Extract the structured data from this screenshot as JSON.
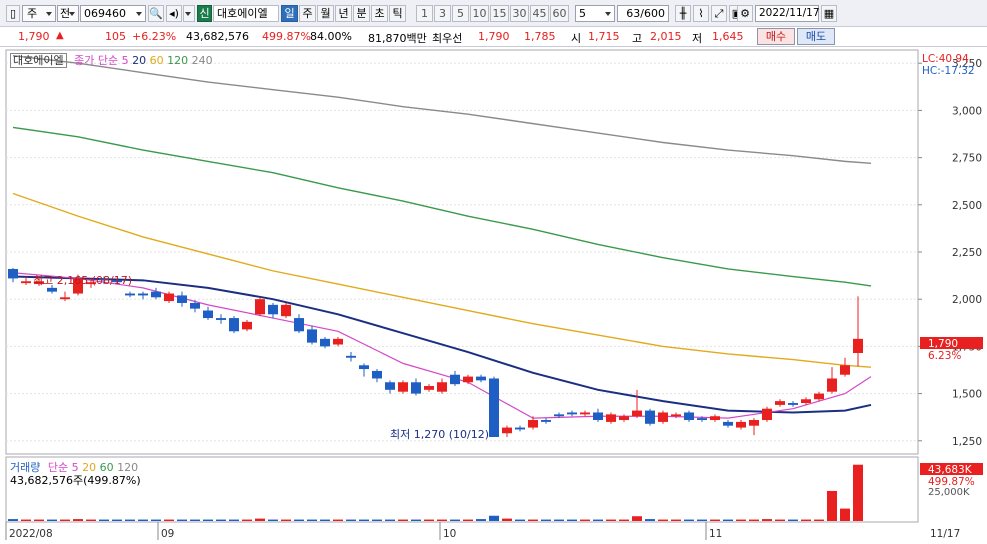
{
  "toolbar": {
    "mode1": "주",
    "mode2": "전",
    "code": "069460",
    "new_badge": "신",
    "name": "대호에이엘",
    "periods": [
      "일",
      "주",
      "월",
      "년",
      "분",
      "초",
      "틱"
    ],
    "selected_period": "일",
    "minutes": [
      "1",
      "3",
      "5",
      "10",
      "15",
      "30",
      "45",
      "60"
    ],
    "interval": "5",
    "count": "63/600",
    "date": "2022/11/17"
  },
  "quote": {
    "price": "1,790",
    "arrow": "▲",
    "change": "105",
    "change_pct": "+6.23%",
    "volume": "43,682,576",
    "volume_ratio": "499.87%",
    "strength": "84.00%",
    "amount": "81,870백만",
    "best_label": "최우선",
    "best_ask": "1,790",
    "best_bid": "1,785",
    "open_label": "시",
    "open": "1,715",
    "high_label": "고",
    "high": "2,015",
    "low_label": "저",
    "low": "1,645",
    "buy": "매수",
    "sell": "매도"
  },
  "price_panel": {
    "name_tag": "대호에이엘",
    "ma_label": "종가 단순",
    "ma_periods": [
      "5",
      "20",
      "60",
      "120",
      "240"
    ],
    "lc": "LC:40.94",
    "hc": "HC:-17.32",
    "last_price": "1,790",
    "last_pct": "6.23%",
    "max_annotation": "최고 2,165 (08/17)",
    "min_annotation": "최저 1,270 (10/12)"
  },
  "volume_panel": {
    "label": "거래량",
    "ma_label": "단순",
    "ma_periods": [
      "5",
      "20",
      "60",
      "120"
    ],
    "value_line": "43,682,576주(499.87%)",
    "last_volume": "43,683K",
    "last_pct": "499.87%",
    "axis_tick": "25,000K"
  },
  "x_axis": {
    "labels": [
      "2022/08",
      "09",
      "10",
      "11"
    ],
    "right_label": "11/17"
  },
  "colors": {
    "up": "#e8201f",
    "down": "#1f5fc4",
    "ma5": "#d448c8",
    "ma20": "#1b2f82",
    "ma60": "#e2aa1a",
    "ma120": "#3a9a4a",
    "ma240": "#8a8a8a"
  },
  "chart_data": {
    "type": "candlestick",
    "y_ticks": [
      1250,
      1500,
      1750,
      2000,
      2250,
      2500,
      2750,
      3000,
      3250
    ],
    "ylim": [
      1180,
      3320
    ],
    "candles": [
      [
        2160,
        2110,
        2165,
        2090
      ],
      [
        2085,
        2095,
        2120,
        2075
      ],
      [
        2080,
        2095,
        2120,
        2070
      ],
      [
        2060,
        2040,
        2075,
        2030
      ],
      [
        2000,
        2010,
        2040,
        1990
      ],
      [
        2030,
        2110,
        2130,
        2020
      ],
      [
        2080,
        2090,
        2110,
        2060
      ],
      [
        2110,
        2100,
        2120,
        2080
      ],
      [
        2100,
        2090,
        2110,
        2080
      ],
      [
        2030,
        2020,
        2040,
        2010
      ],
      [
        2030,
        2020,
        2040,
        2000
      ],
      [
        2040,
        2010,
        2060,
        2000
      ],
      [
        1990,
        2030,
        2040,
        1980
      ],
      [
        2020,
        1980,
        2040,
        1960
      ],
      [
        1980,
        1950,
        1995,
        1930
      ],
      [
        1940,
        1900,
        1960,
        1890
      ],
      [
        1900,
        1890,
        1920,
        1870
      ],
      [
        1900,
        1830,
        1910,
        1820
      ],
      [
        1840,
        1880,
        1890,
        1830
      ],
      [
        1920,
        2000,
        2010,
        1910
      ],
      [
        1970,
        1920,
        1980,
        1900
      ],
      [
        1910,
        1970,
        1980,
        1900
      ],
      [
        1900,
        1830,
        1920,
        1820
      ],
      [
        1840,
        1770,
        1860,
        1760
      ],
      [
        1790,
        1750,
        1800,
        1740
      ],
      [
        1760,
        1790,
        1800,
        1750
      ],
      [
        1700,
        1690,
        1720,
        1670
      ],
      [
        1650,
        1630,
        1660,
        1590
      ],
      [
        1620,
        1580,
        1630,
        1560
      ],
      [
        1560,
        1520,
        1570,
        1500
      ],
      [
        1510,
        1560,
        1570,
        1500
      ],
      [
        1560,
        1500,
        1580,
        1490
      ],
      [
        1520,
        1540,
        1550,
        1510
      ],
      [
        1510,
        1560,
        1580,
        1500
      ],
      [
        1600,
        1550,
        1620,
        1540
      ],
      [
        1560,
        1590,
        1600,
        1550
      ],
      [
        1590,
        1570,
        1600,
        1560
      ],
      [
        1580,
        1270,
        1590,
        1270
      ],
      [
        1290,
        1320,
        1330,
        1270
      ],
      [
        1320,
        1310,
        1330,
        1300
      ],
      [
        1320,
        1360,
        1380,
        1310
      ],
      [
        1360,
        1350,
        1370,
        1340
      ],
      [
        1390,
        1380,
        1400,
        1370
      ],
      [
        1400,
        1390,
        1410,
        1380
      ],
      [
        1390,
        1400,
        1410,
        1380
      ],
      [
        1400,
        1360,
        1420,
        1350
      ],
      [
        1350,
        1390,
        1400,
        1340
      ],
      [
        1360,
        1380,
        1390,
        1350
      ],
      [
        1380,
        1410,
        1520,
        1370
      ],
      [
        1410,
        1340,
        1420,
        1330
      ],
      [
        1350,
        1400,
        1410,
        1340
      ],
      [
        1380,
        1390,
        1400,
        1370
      ],
      [
        1400,
        1360,
        1410,
        1350
      ],
      [
        1370,
        1360,
        1380,
        1350
      ],
      [
        1360,
        1380,
        1390,
        1350
      ],
      [
        1350,
        1330,
        1360,
        1320
      ],
      [
        1320,
        1350,
        1360,
        1310
      ],
      [
        1330,
        1360,
        1370,
        1280
      ],
      [
        1360,
        1420,
        1430,
        1350
      ],
      [
        1440,
        1460,
        1470,
        1430
      ],
      [
        1450,
        1440,
        1460,
        1430
      ],
      [
        1450,
        1470,
        1480,
        1440
      ],
      [
        1470,
        1500,
        1510,
        1460
      ],
      [
        1510,
        1580,
        1640,
        1500
      ],
      [
        1600,
        1650,
        1690,
        1590
      ],
      [
        1715,
        1790,
        2015,
        1645
      ]
    ],
    "ma5": [
      [
        0,
        2140
      ],
      [
        5,
        2110
      ],
      [
        10,
        2060
      ],
      [
        15,
        1970
      ],
      [
        20,
        1900
      ],
      [
        25,
        1830
      ],
      [
        30,
        1660
      ],
      [
        35,
        1560
      ],
      [
        40,
        1370
      ],
      [
        45,
        1380
      ],
      [
        50,
        1380
      ],
      [
        55,
        1370
      ],
      [
        60,
        1420
      ],
      [
        64,
        1500
      ],
      [
        66,
        1590
      ]
    ],
    "ma20": [
      [
        0,
        2120
      ],
      [
        5,
        2110
      ],
      [
        10,
        2100
      ],
      [
        15,
        2060
      ],
      [
        20,
        2000
      ],
      [
        25,
        1920
      ],
      [
        30,
        1820
      ],
      [
        35,
        1720
      ],
      [
        40,
        1610
      ],
      [
        45,
        1520
      ],
      [
        50,
        1460
      ],
      [
        55,
        1410
      ],
      [
        60,
        1400
      ],
      [
        64,
        1410
      ],
      [
        66,
        1440
      ]
    ],
    "ma60": [
      [
        0,
        2560
      ],
      [
        5,
        2440
      ],
      [
        10,
        2330
      ],
      [
        15,
        2240
      ],
      [
        20,
        2150
      ],
      [
        25,
        2080
      ],
      [
        30,
        2010
      ],
      [
        35,
        1940
      ],
      [
        40,
        1870
      ],
      [
        45,
        1810
      ],
      [
        50,
        1750
      ],
      [
        55,
        1710
      ],
      [
        60,
        1680
      ],
      [
        64,
        1650
      ],
      [
        66,
        1640
      ]
    ],
    "ma120": [
      [
        0,
        2910
      ],
      [
        5,
        2860
      ],
      [
        10,
        2790
      ],
      [
        15,
        2730
      ],
      [
        20,
        2670
      ],
      [
        25,
        2590
      ],
      [
        30,
        2520
      ],
      [
        35,
        2440
      ],
      [
        40,
        2370
      ],
      [
        45,
        2290
      ],
      [
        50,
        2220
      ],
      [
        55,
        2160
      ],
      [
        60,
        2120
      ],
      [
        64,
        2090
      ],
      [
        66,
        2070
      ]
    ],
    "ma240": [
      [
        0,
        3290
      ],
      [
        5,
        3250
      ],
      [
        10,
        3200
      ],
      [
        15,
        3150
      ],
      [
        20,
        3110
      ],
      [
        25,
        3070
      ],
      [
        30,
        3020
      ],
      [
        35,
        2980
      ],
      [
        40,
        2930
      ],
      [
        45,
        2880
      ],
      [
        50,
        2830
      ],
      [
        55,
        2790
      ],
      [
        60,
        2760
      ],
      [
        64,
        2730
      ],
      [
        66,
        2720
      ]
    ],
    "volumes": [
      0.4,
      0.3,
      0.3,
      0.3,
      0.3,
      0.4,
      0.3,
      0.3,
      0.3,
      0.3,
      0.3,
      0.3,
      0.3,
      0.3,
      0.3,
      0.3,
      0.3,
      0.3,
      0.3,
      0.5,
      0.3,
      0.3,
      0.3,
      0.3,
      0.3,
      0.3,
      0.3,
      0.3,
      0.3,
      0.3,
      0.3,
      0.3,
      0.3,
      0.3,
      0.3,
      0.3,
      0.4,
      1.1,
      0.5,
      0.3,
      0.3,
      0.3,
      0.3,
      0.3,
      0.3,
      0.3,
      0.3,
      0.3,
      1.0,
      0.4,
      0.3,
      0.3,
      0.3,
      0.3,
      0.3,
      0.3,
      0.3,
      0.3,
      0.4,
      0.3,
      0.3,
      0.3,
      0.3,
      6.3,
      2.6,
      11.8
    ],
    "volume_max": 13
  }
}
